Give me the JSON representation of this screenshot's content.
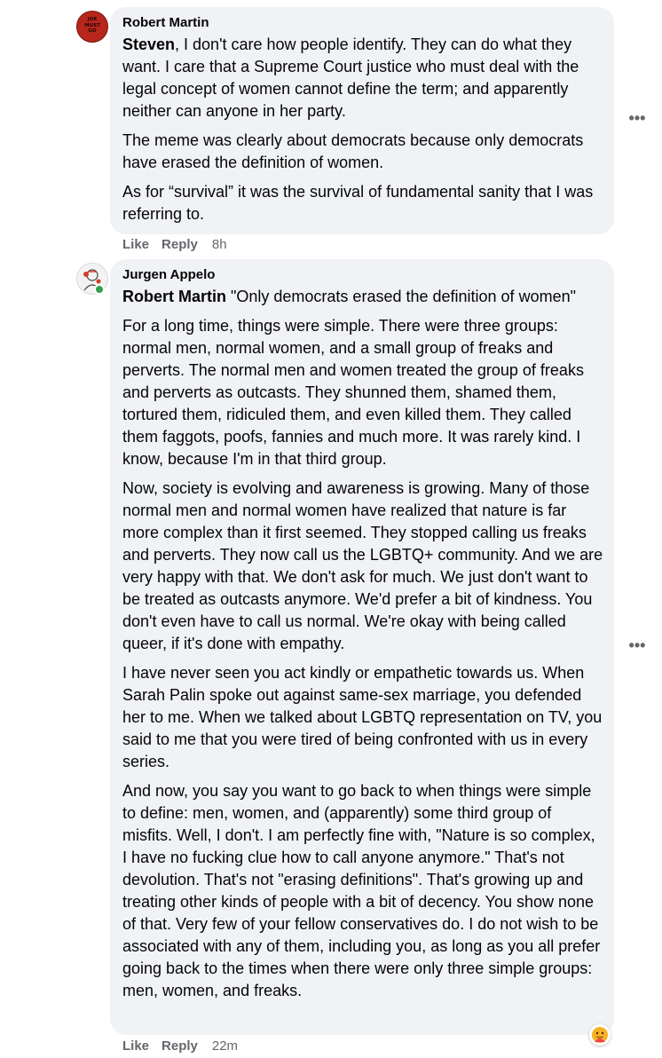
{
  "comments": [
    {
      "author": "Robert Martin",
      "avatar_text": "JOE\nMUST\nGO",
      "mention": "Steven",
      "paragraphs": [
        ", I don't care how people identify. They can do what they want. I care that a Supreme Court justice who must deal with the legal concept of women cannot define the term; and apparently neither can anyone in her party.",
        "The meme was clearly about democrats because only democrats have erased the definition of women.",
        "As for “survival” it was the survival of fundamental sanity that I was referring to."
      ],
      "like_label": "Like",
      "reply_label": "Reply",
      "time": "8h"
    },
    {
      "author": "Jurgen Appelo",
      "mention": "Robert Martin",
      "quote": " \"Only democrats erased the definition of women\"",
      "paragraphs": [
        "For a long time, things were simple. There were three groups: normal men, normal women, and a small group of freaks and perverts. The normal men and women treated the group of freaks and perverts as outcasts. They shunned them, shamed them, tortured them, ridiculed them, and even killed them. They called them faggots, poofs, fannies and much more. It was rarely kind. I know, because I'm in that third group.",
        "Now, society is evolving and awareness is growing. Many of those normal men and normal women have realized that nature is far more complex than it first seemed. They stopped calling us freaks and perverts. They now call us the LGBTQ+ community. And we are very happy with that. We don't ask for much. We just don't want to be treated as outcasts anymore. We'd prefer a bit of kindness. You don't even have to call us normal. We're okay with being called queer, if it's done with empathy.",
        "I have never seen you act kindly or empathetic towards us. When Sarah Palin spoke out against same-sex marriage, you defended her to me. When we talked about LGBTQ representation on TV, you said to me that you were tired of being confronted with us in every series.",
        "And now, you say you want to go back to when things were simple to define: men, women, and (apparently) some third group of misfits. Well, I don't. I am perfectly fine with, \"Nature is so complex, I have no fucking clue how to call anyone anymore.\" That's not devolution. That's not \"erasing definitions\". That's growing up and treating other kinds of people with a bit of decency. You show none of that. Very few of your fellow conservatives do. I do not wish to be associated with any of them, including you, as long as you all prefer going back to the times when there were only three simple groups: men, women, and freaks."
      ],
      "like_label": "Like",
      "reply_label": "Reply",
      "time": "22m",
      "reaction_icon": "care-reaction-icon"
    }
  ],
  "more_options_glyph": "•••",
  "colors": {
    "bubble": "#f0f2f5",
    "secondary_text": "#65676b",
    "avatar_red": "#b8261c",
    "online": "#31a24c"
  }
}
